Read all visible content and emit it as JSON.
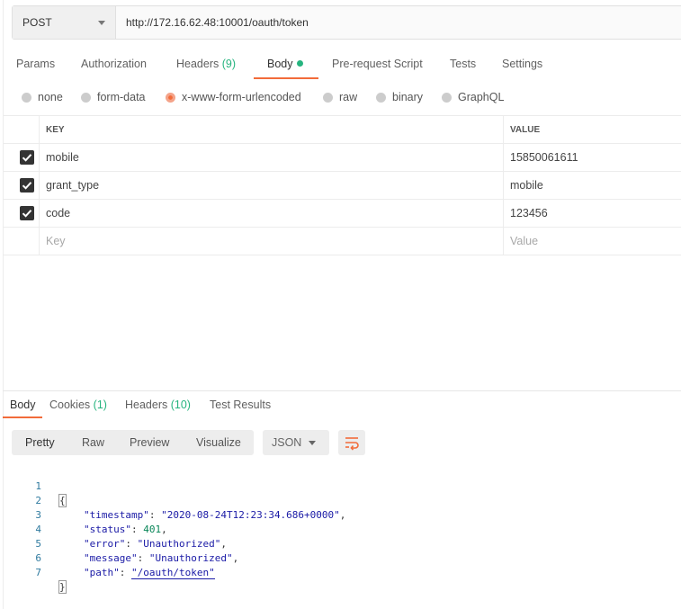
{
  "request": {
    "method": "POST",
    "url": "http://172.16.62.48:10001/oauth/token"
  },
  "request_tabs": [
    {
      "label": "Params"
    },
    {
      "label": "Authorization"
    },
    {
      "label": "Headers",
      "count": "(9)"
    },
    {
      "label": "Body"
    },
    {
      "label": "Pre-request Script"
    },
    {
      "label": "Tests"
    },
    {
      "label": "Settings"
    }
  ],
  "body_types": [
    {
      "label": "none"
    },
    {
      "label": "form-data"
    },
    {
      "label": "x-www-form-urlencoded"
    },
    {
      "label": "raw"
    },
    {
      "label": "binary"
    },
    {
      "label": "GraphQL"
    }
  ],
  "kv_table": {
    "headers": {
      "key": "KEY",
      "value": "VALUE"
    },
    "rows": [
      {
        "key": "mobile",
        "value": "15850061611",
        "checked": true
      },
      {
        "key": "grant_type",
        "value": "mobile",
        "checked": true
      },
      {
        "key": "code",
        "value": "123456",
        "checked": true
      }
    ],
    "placeholder": {
      "key": "Key",
      "value": "Value"
    }
  },
  "response_tabs": [
    {
      "label": "Body"
    },
    {
      "label": "Cookies",
      "count": "(1)"
    },
    {
      "label": "Headers",
      "count": "(10)"
    },
    {
      "label": "Test Results"
    }
  ],
  "view_modes": [
    "Pretty",
    "Raw",
    "Preview",
    "Visualize"
  ],
  "format": "JSON",
  "code": {
    "line_numbers": [
      "1",
      "2",
      "3",
      "4",
      "5",
      "6",
      "7"
    ],
    "open_brace": "{",
    "close_brace": "}",
    "fields": [
      {
        "key": "\"timestamp\"",
        "value": "\"2020-08-24T12:23:34.686+0000\"",
        "comma": ","
      },
      {
        "key": "\"status\"",
        "value": "401",
        "comma": ","
      },
      {
        "key": "\"error\"",
        "value": "\"Unauthorized\"",
        "comma": ","
      },
      {
        "key": "\"message\"",
        "value": "\"Unauthorized\"",
        "comma": ","
      },
      {
        "key": "\"path\"",
        "value": "\"/oauth/token\"",
        "comma": ""
      }
    ]
  },
  "colors": {
    "accent": "#f26b3a",
    "count_green": "#26b47f",
    "json_key": "#1a1aa6",
    "json_number": "#098658",
    "line_number": "#2f7a9f"
  }
}
